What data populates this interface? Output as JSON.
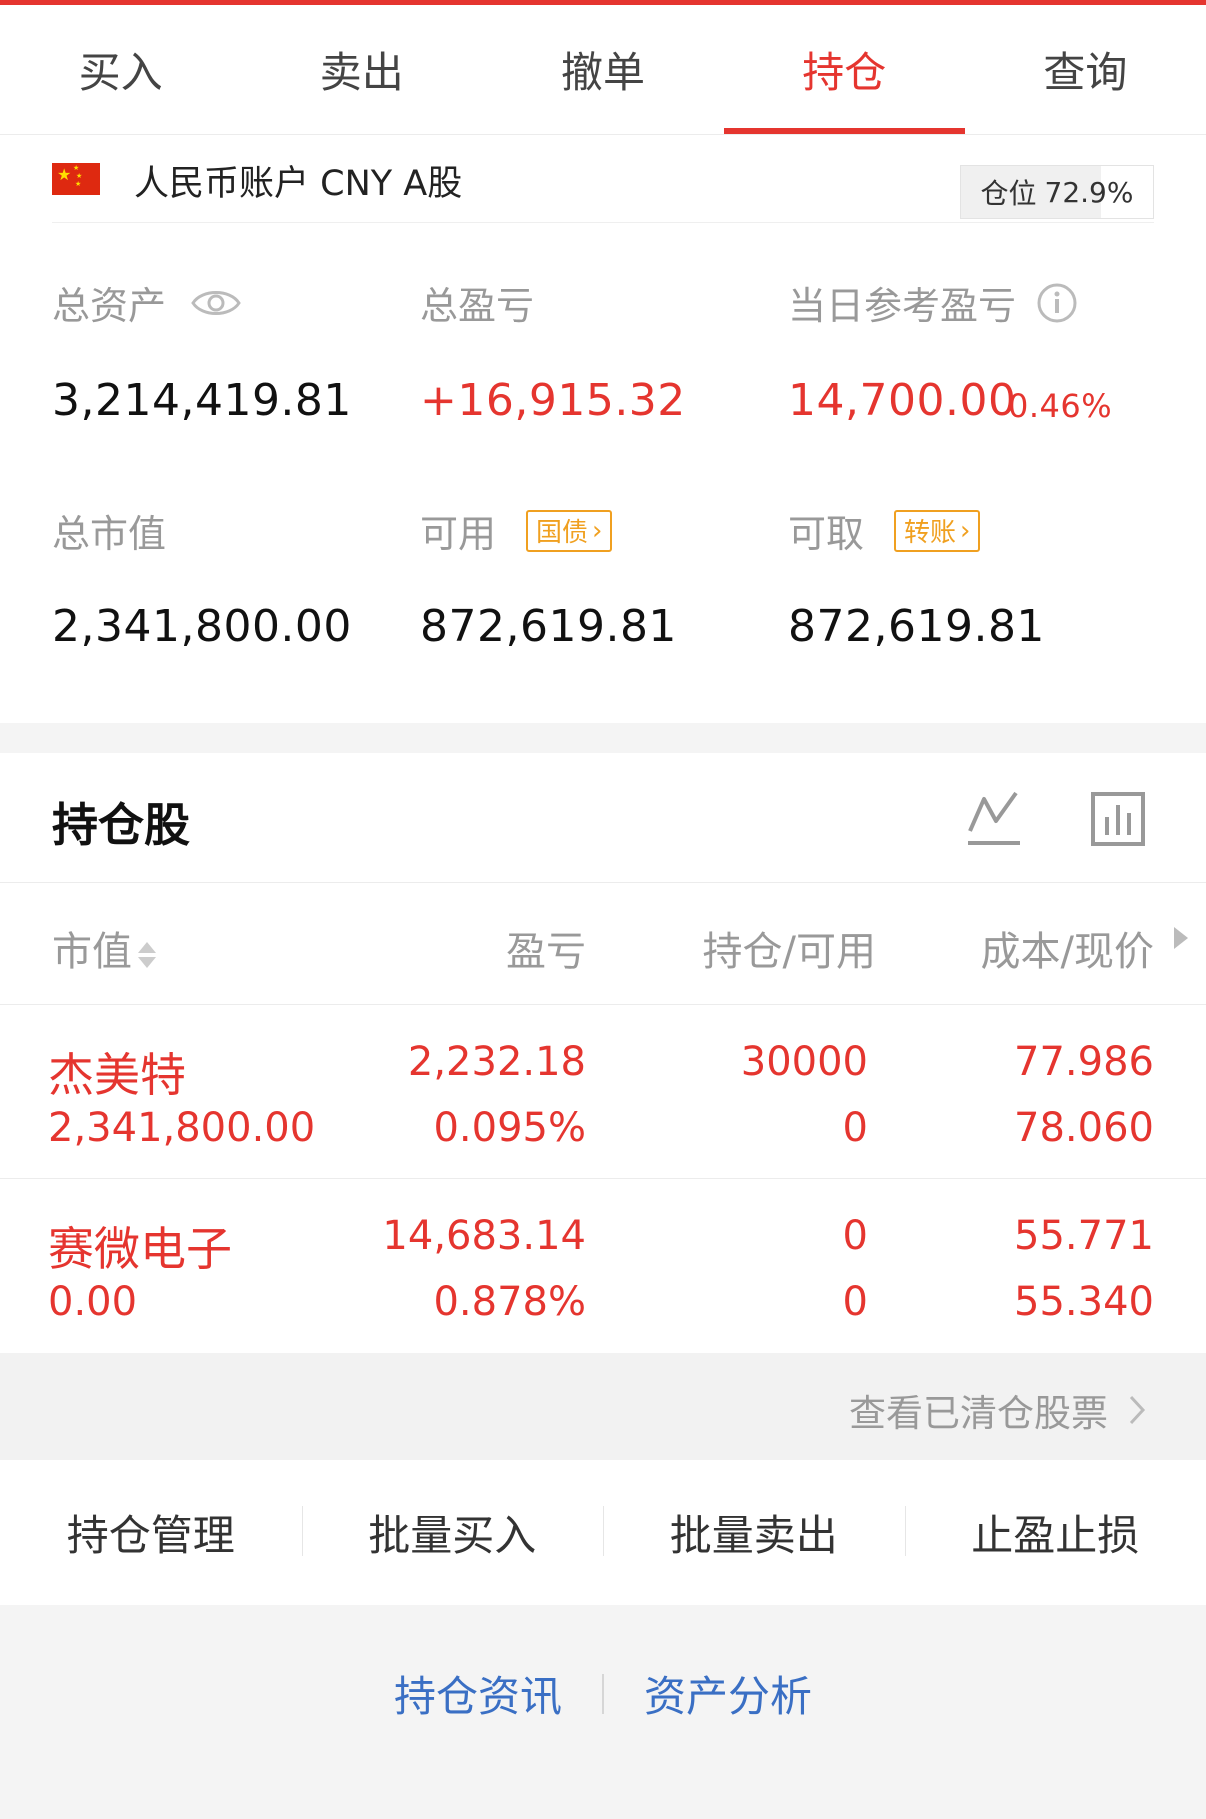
{
  "tabs": [
    {
      "label": "买入",
      "active": false
    },
    {
      "label": "卖出",
      "active": false
    },
    {
      "label": "撤单",
      "active": false
    },
    {
      "label": "持仓",
      "active": true
    },
    {
      "label": "查询",
      "active": false
    }
  ],
  "account": {
    "label": "人民币账户 CNY A股",
    "flag_icon": "china-flag-icon",
    "position_label": "仓位",
    "position_value": "72.9%",
    "position_fraction": 0.729
  },
  "metrics": {
    "total_assets_label": "总资产",
    "total_assets": "3,214,419.81",
    "total_pnl_label": "总盈亏",
    "total_pnl": "+16,915.32",
    "daily_pnl_label": "当日参考盈亏",
    "daily_pnl": "14,700.00",
    "daily_pnl_pct": "0.46%",
    "market_value_label": "总市值",
    "market_value": "2,341,800.00",
    "available_label": "可用",
    "available_tag": "国债",
    "available": "872,619.81",
    "withdrawable_label": "可取",
    "withdrawable_tag": "转账",
    "withdrawable": "872,619.81"
  },
  "holdings": {
    "title": "持仓股",
    "columns": {
      "market_value": "市值",
      "pnl": "盈亏",
      "position": "持仓/可用",
      "cost": "成本/现价"
    },
    "rows": [
      {
        "name": "杰美特",
        "market_value": "2,341,800.00",
        "pnl": "2,232.18",
        "pnl_pct": "0.095%",
        "position": "30000",
        "available": "0",
        "cost": "77.986",
        "price": "78.060"
      },
      {
        "name": "赛微电子",
        "market_value": "0.00",
        "pnl": "14,683.14",
        "pnl_pct": "0.878%",
        "position": "0",
        "available": "0",
        "cost": "55.771",
        "price": "55.340"
      }
    ],
    "cleared_link": "查看已清仓股票"
  },
  "actions": [
    "持仓管理",
    "批量买入",
    "批量卖出",
    "止盈止损"
  ],
  "bottom_links": [
    "持仓资讯",
    "资产分析"
  ],
  "colors": {
    "accent": "#e5352f",
    "tag": "#f0a020",
    "link": "#3a6fc4"
  }
}
